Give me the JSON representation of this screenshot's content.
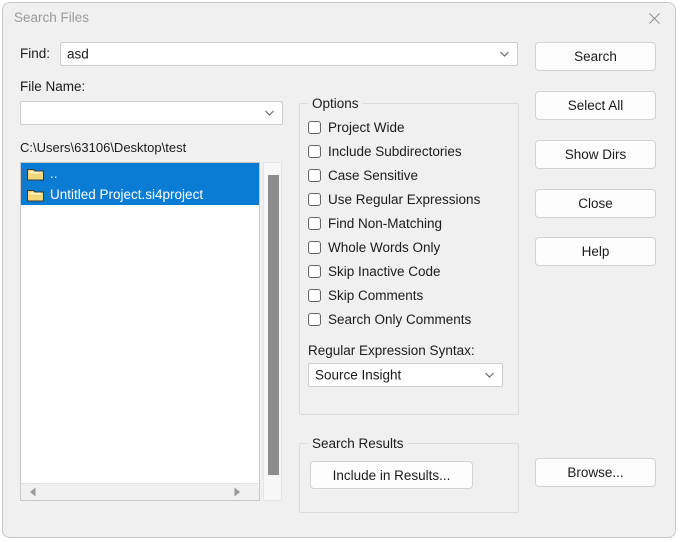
{
  "window": {
    "title": "Search Files",
    "close_icon": "close-icon"
  },
  "find": {
    "label": "Find:",
    "value": "asd",
    "chevron_icon": "chevron-down-icon"
  },
  "file_name": {
    "label": "File Name:",
    "value": "",
    "placeholder": "",
    "chevron_icon": "chevron-down-icon"
  },
  "path": {
    "text": "C:\\Users\\63106\\Desktop\\test"
  },
  "file_list": {
    "items": [
      {
        "label": "..",
        "icon": "folder-icon",
        "selected": true
      },
      {
        "label": "Untitled Project.si4project",
        "icon": "folder-icon",
        "selected": true
      }
    ],
    "h_scrollbar": {
      "left_arrow_icon": "arrow-left-icon",
      "right_arrow_icon": "arrow-right-icon"
    }
  },
  "options": {
    "title": "Options",
    "items": [
      {
        "label": "Project Wide",
        "checked": false
      },
      {
        "label": "Include Subdirectories",
        "checked": false
      },
      {
        "label": "Case Sensitive",
        "checked": false
      },
      {
        "label": "Use Regular Expressions",
        "checked": false
      },
      {
        "label": "Find Non-Matching",
        "checked": false
      },
      {
        "label": "Whole Words Only",
        "checked": false
      },
      {
        "label": "Skip Inactive Code",
        "checked": false
      },
      {
        "label": "Skip Comments",
        "checked": false
      },
      {
        "label": "Search Only Comments",
        "checked": false
      }
    ],
    "regex_syntax": {
      "label": "Regular Expression Syntax:",
      "value": "Source Insight",
      "chevron_icon": "chevron-down-icon"
    }
  },
  "search_results": {
    "title": "Search Results",
    "include_button": "Include in Results..."
  },
  "buttons": {
    "search": "Search",
    "select_all": "Select All",
    "show_dirs": "Show Dirs",
    "close": "Close",
    "help": "Help",
    "browse": "Browse..."
  },
  "colors": {
    "selection": "#0a7cd4",
    "dialog_bg": "#f0f0f0",
    "text": "#1b1b1b",
    "title_text": "#9a9a9a",
    "folder": "#f0d878"
  }
}
